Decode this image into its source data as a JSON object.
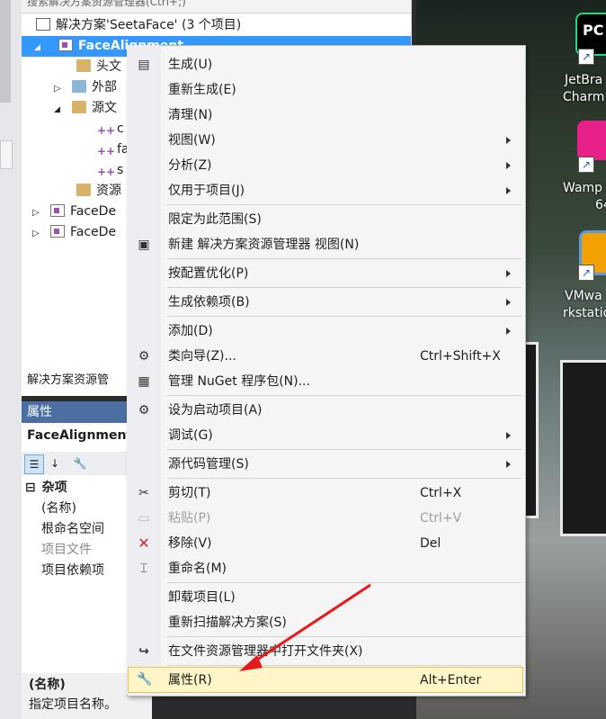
{
  "solution_explorer": {
    "search_placeholder": "搜索解决方案资源管理器(Ctrl+;)",
    "solution_label": "解决方案'SeetaFace' (3 个项目)",
    "selected_project": "FaceAlignment",
    "items": [
      "头文",
      "外部",
      "源文",
      "c",
      "fa",
      "s",
      "资源",
      "FaceDe",
      "FaceDe"
    ],
    "footer_tab": "解决方案资源管"
  },
  "properties": {
    "title": "属性",
    "object": "FaceAlignment",
    "category": "杂项",
    "rows": [
      "(名称)",
      "根命名空间",
      "项目文件",
      "项目依赖项"
    ],
    "desc_title": "(名称)",
    "desc_text": "指定项目名称。"
  },
  "desktop": {
    "icons": [
      {
        "line1": "JetBra",
        "line2": "Charm",
        "color": "#21d789"
      },
      {
        "line1": "Wamp",
        "line2": "64",
        "color": "#e8208a"
      },
      {
        "line1": "VMwa",
        "line2": "rkstatio",
        "color": "#f2a100"
      }
    ],
    "badge_text": "PC"
  },
  "context_menu": {
    "items": [
      {
        "label": "生成(U)",
        "icon": "build-icon"
      },
      {
        "label": "重新生成(E)"
      },
      {
        "label": "清理(N)"
      },
      {
        "label": "视图(W)",
        "submenu": true
      },
      {
        "label": "分析(Z)",
        "submenu": true
      },
      {
        "label": "仅用于项目(J)",
        "submenu": true
      },
      {
        "label": "限定为此范围(S)"
      },
      {
        "label": "新建 解决方案资源管理器 视图(N)",
        "icon": "new-view-icon"
      },
      {
        "label": "按配置优化(P)",
        "submenu": true
      },
      {
        "label": "生成依赖项(B)",
        "submenu": true
      },
      {
        "label": "添加(D)",
        "submenu": true
      },
      {
        "label": "类向导(Z)...",
        "shortcut": "Ctrl+Shift+X",
        "icon": "class-wizard-icon"
      },
      {
        "label": "管理 NuGet 程序包(N)...",
        "icon": "nuget-icon"
      },
      {
        "label": "设为启动项目(A)",
        "icon": "gear-icon"
      },
      {
        "label": "调试(G)",
        "submenu": true
      },
      {
        "label": "源代码管理(S)",
        "submenu": true
      },
      {
        "label": "剪切(T)",
        "shortcut": "Ctrl+X",
        "icon": "scissors-icon"
      },
      {
        "label": "粘贴(P)",
        "shortcut": "Ctrl+V",
        "icon": "paste-icon",
        "disabled": true
      },
      {
        "label": "移除(V)",
        "shortcut": "Del",
        "icon": "remove-icon"
      },
      {
        "label": "重命名(M)",
        "icon": "rename-icon"
      },
      {
        "label": "卸载项目(L)"
      },
      {
        "label": "重新扫描解决方案(S)"
      },
      {
        "label": "在文件资源管理器中打开文件夹(X)",
        "icon": "open-folder-arrow-icon"
      },
      {
        "label": "属性(R)",
        "shortcut": "Alt+Enter",
        "icon": "wrench-icon",
        "highlighted": true
      }
    ]
  },
  "colors": {
    "selection": "#3399ff",
    "menu_highlight": "#fff5c6",
    "annotation_arrow": "#e8191b"
  }
}
